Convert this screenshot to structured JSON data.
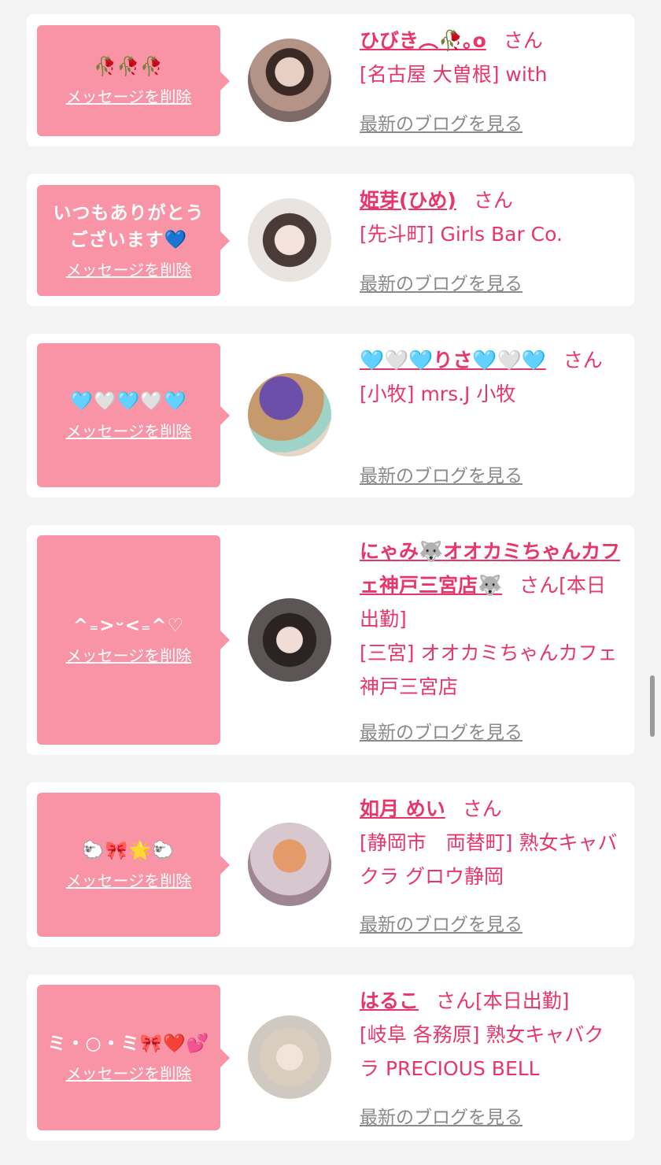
{
  "delete_label": "メッセージを削除",
  "blog_label": "最新のブログを見る",
  "san_label": "さん",
  "colors": {
    "bubble": "#f993a6",
    "accent": "#e8366b",
    "link_gray": "#8a8a8a",
    "bg": "#f3f3f3"
  },
  "cards": [
    {
      "message": "🥀🥀🥀",
      "name": "ひびき︵🥀｡o",
      "status": "",
      "shop": "[名古屋 大曽根] with",
      "avatar": "avatar-photo"
    },
    {
      "message": "いつもありがとう\nございます💙",
      "name": "姫芽(ひめ)",
      "status": "",
      "shop": "[先斗町] Girls Bar Co.",
      "avatar": "avatar-photo"
    },
    {
      "message": "🩵🤍🩵🤍🩵",
      "name": "🩵🤍🩵りさ🩵🤍🩵",
      "status": "",
      "shop": "[小牧] mrs.J 小牧",
      "avatar": "avatar-photo"
    },
    {
      "message": "^₌>ᵕ<₌^♡",
      "name": "にゃみ🐺オオカミちゃんカフェ神戸三宮店🐺",
      "status": "[本日出勤]",
      "shop": "[三宮] オオカミちゃんカフェ神戸三宮店",
      "avatar": "avatar-photo"
    },
    {
      "message": "🐑🎀🌟🐑",
      "name": "如月 めい",
      "status": "",
      "shop": "[静岡市　両替町] 熟女キャバクラ グロウ静岡",
      "avatar": "avatar-photo"
    },
    {
      "message": "ミ・○・ミ🎀❤️💕",
      "name": "はるこ",
      "status": "[本日出勤]",
      "shop": "[岐阜 各務原]  熟女キャバクラ PRECIOUS BELL",
      "avatar": "avatar-photo"
    }
  ]
}
